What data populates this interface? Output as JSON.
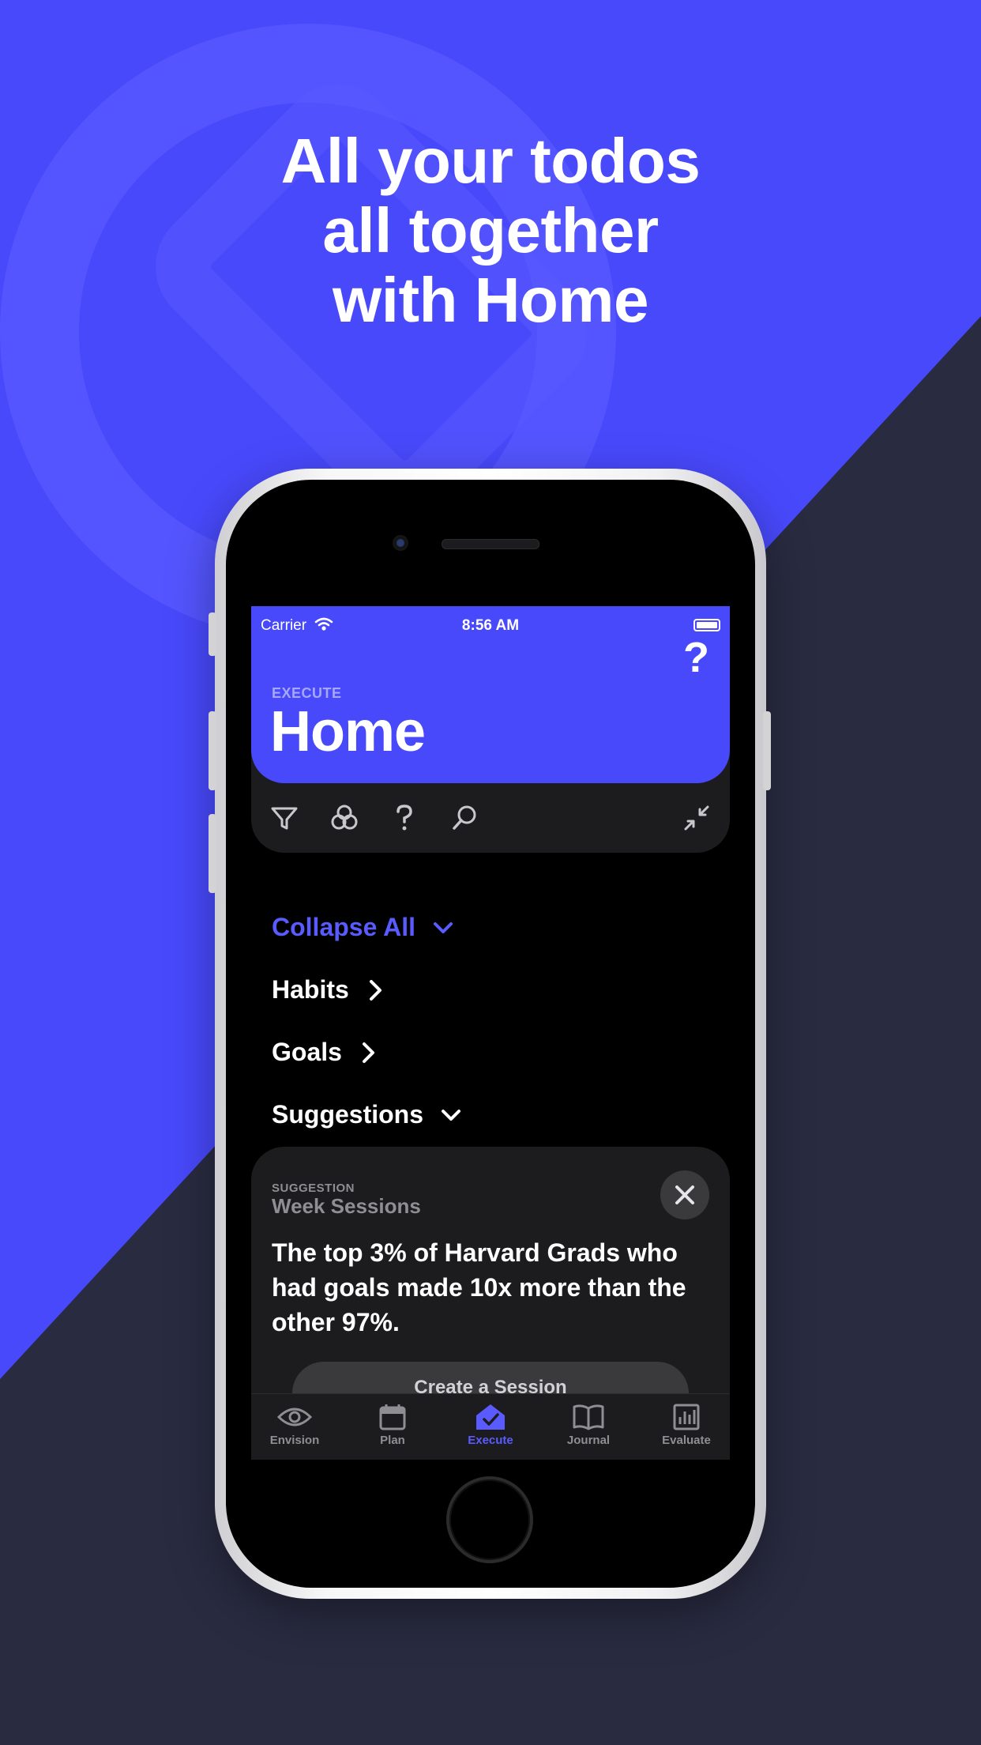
{
  "headline": [
    "All your todos",
    "all together",
    "with Home"
  ],
  "colors": {
    "brand": "#4849fb",
    "dark": "#292b41",
    "accent": "#5a5bff"
  },
  "status_bar": {
    "carrier": "Carrier",
    "time": "8:56 AM"
  },
  "header": {
    "overline": "EXECUTE",
    "title": "Home",
    "help_icon": "question-mark-icon"
  },
  "toolbar": {
    "icons": [
      "filter-icon",
      "circles-icon",
      "question-icon",
      "search-icon",
      "collapse-icon"
    ]
  },
  "sections": {
    "collapse_all": "Collapse All",
    "habits": "Habits",
    "goals": "Goals",
    "suggestions": "Suggestions"
  },
  "suggestion_card": {
    "overline": "SUGGESTION",
    "subtitle": "Week Sessions",
    "body": "The top 3% of Harvard Grads who had goals made 10x more than the other 97%.",
    "cta": "Create a Session"
  },
  "tabs": [
    {
      "label": "Envision",
      "icon": "eye-icon"
    },
    {
      "label": "Plan",
      "icon": "calendar-icon"
    },
    {
      "label": "Execute",
      "icon": "home-check-icon",
      "active": true
    },
    {
      "label": "Journal",
      "icon": "book-icon"
    },
    {
      "label": "Evaluate",
      "icon": "chart-icon"
    }
  ]
}
